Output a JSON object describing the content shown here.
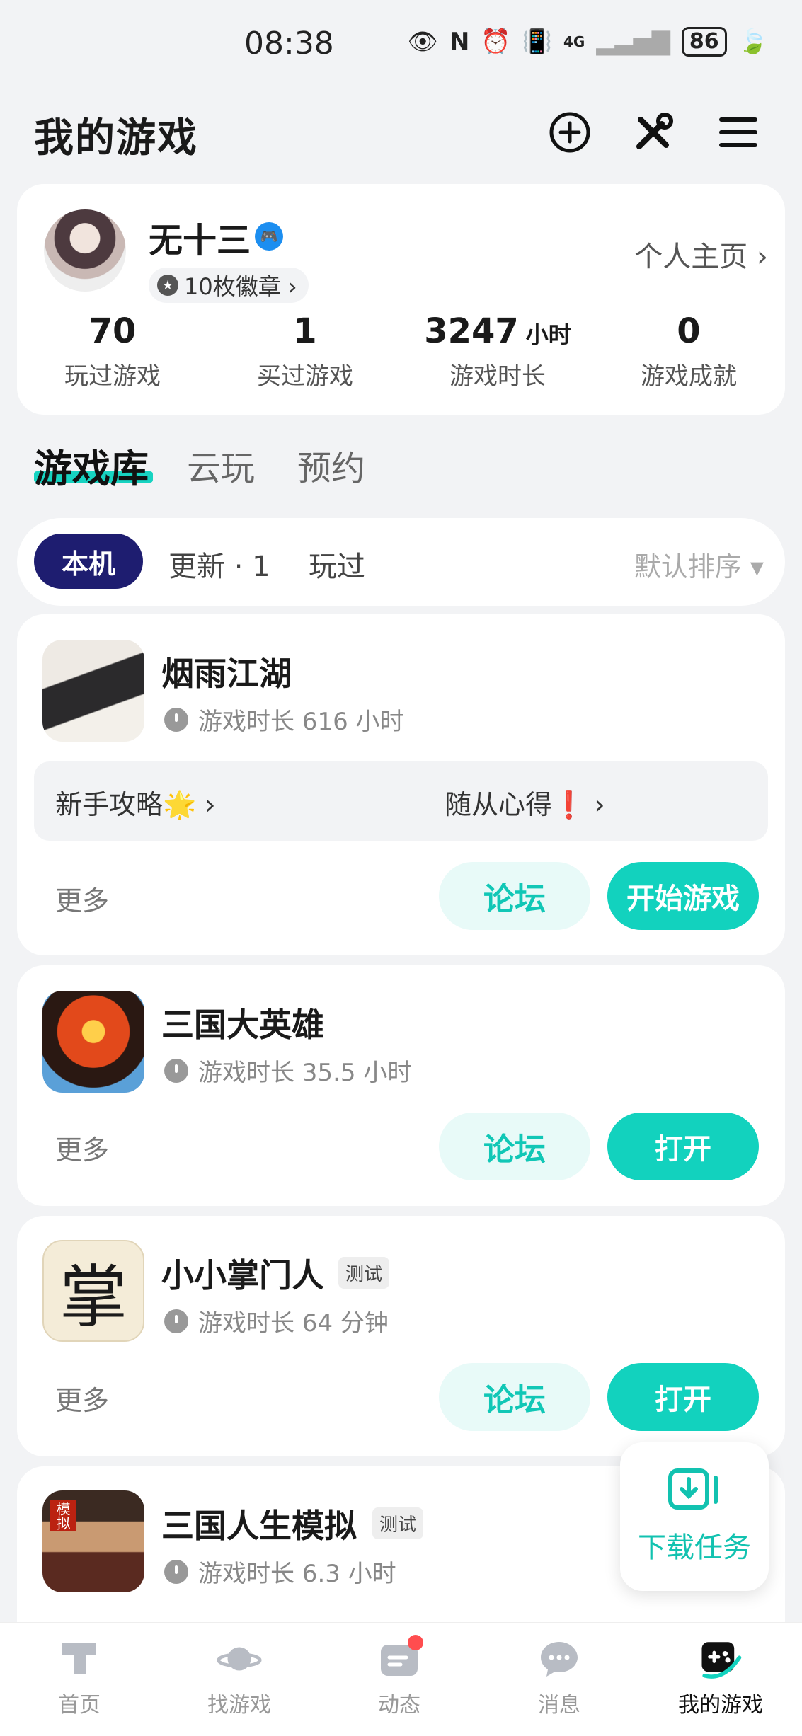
{
  "status_bar": {
    "time": "08:38",
    "network": "4G",
    "battery": "86"
  },
  "header": {
    "title": "我的游戏",
    "icons": [
      "add-circle-icon",
      "tools-icon",
      "menu-icon"
    ]
  },
  "profile": {
    "username": "无十三",
    "badges": "10枚徽章 ›",
    "home_link": "个人主页 ›",
    "stats": [
      {
        "value": "70",
        "unit": "",
        "label": "玩过游戏"
      },
      {
        "value": "1",
        "unit": "",
        "label": "买过游戏"
      },
      {
        "value": "3247",
        "unit": "小时",
        "label": "游戏时长"
      },
      {
        "value": "0",
        "unit": "",
        "label": "游戏成就"
      }
    ]
  },
  "tabs": [
    "游戏库",
    "云玩",
    "预约"
  ],
  "filters": {
    "active": "本机",
    "items": [
      "更新 · 1",
      "玩过"
    ],
    "sort": "默认排序 ▾"
  },
  "games": [
    {
      "name": "烟雨江湖",
      "playtime": "游戏时长 616 小时",
      "guides": [
        "新手攻略🌟 ›",
        "随从心得❗ ›"
      ],
      "more": "更多",
      "forum": "论坛",
      "action": "开始游戏"
    },
    {
      "name": "三国大英雄",
      "playtime": "游戏时长 35.5 小时",
      "more": "更多",
      "forum": "论坛",
      "action": "打开"
    },
    {
      "name": "小小掌门人",
      "tag": "测试",
      "icon_char": "掌",
      "playtime": "游戏时长 64 分钟",
      "more": "更多",
      "forum": "论坛",
      "action": "打开"
    },
    {
      "name": "三国人生模拟",
      "tag": "测试",
      "icon_char": "模拟",
      "playtime": "游戏时长 6.3 小时"
    }
  ],
  "download_task": "下载任务",
  "bottom_nav": [
    {
      "label": "首页"
    },
    {
      "label": "找游戏"
    },
    {
      "label": "动态"
    },
    {
      "label": "消息"
    },
    {
      "label": "我的游戏"
    }
  ],
  "colors": {
    "accent": "#12d2be",
    "active_pill": "#1e1d70",
    "badge_dot": "#ff4d4f"
  }
}
